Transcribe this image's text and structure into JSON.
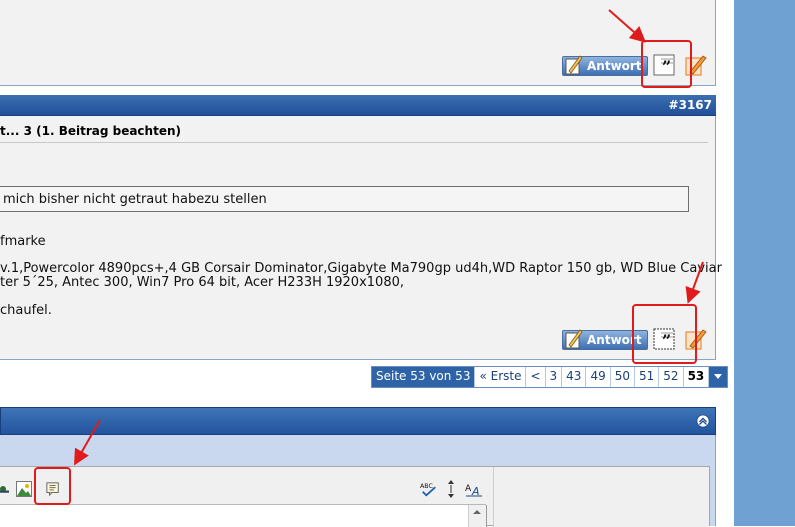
{
  "post1": {
    "reply_button_label": "Antwort"
  },
  "post2": {
    "post_number": "#3167",
    "title": "t... 3 (1. Beitrag beachten)",
    "quote_text": "mich bisher nicht getraut habezu stellen",
    "line_marke": "fmarke",
    "line_specs_1": "v.1,Powercolor 4890pcs+,4 GB Corsair Dominator,Gigabyte Ma790gp ud4h,WD Raptor 150 gb, WD Blue Caviar",
    "line_specs_2": "ter 5´25, Antec 300, Win7 Pro 64 bit, Acer H233H 1920x1080,",
    "line_schaufel": "chaufel.",
    "reply_button_label": "Antwort"
  },
  "pager": {
    "page_info": "Seite 53 von 53",
    "first_label": "« Erste",
    "prev_label": "<",
    "pages": [
      "3",
      "43",
      "49",
      "50",
      "51",
      "52"
    ],
    "current_page": "53"
  },
  "colors": {
    "highlight_red": "#e01b1b",
    "header_blue": "#2a5ea5",
    "side_blue": "#6fa1d3"
  },
  "icons": {
    "quote": "quote-icon",
    "edit": "pencil-icon",
    "collapse": "collapse-icon",
    "spellcheck": "spellcheck-icon",
    "resize": "resize-icon",
    "text_direction": "text-direction-icon",
    "insert_image": "insert-image-icon",
    "insert_quote": "insert-quote-icon"
  }
}
